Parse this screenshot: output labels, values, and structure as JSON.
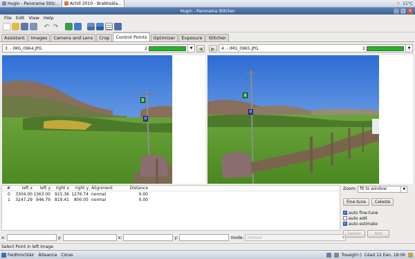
{
  "topbar": {
    "tabs": [
      {
        "label": "Hugin - Panorama Stitc...",
        "active": false
      },
      {
        "label": "Achill 2010 - Brabhsála...",
        "active": true
      }
    ],
    "weather": "11°C"
  },
  "window": {
    "title": "Hugin - Panorama Stitcher"
  },
  "menu": {
    "file": "File",
    "edit": "Edit",
    "view": "View",
    "help": "Help"
  },
  "toolbar": {
    "icons": [
      "new-icon",
      "open-icon",
      "save-icon",
      "save-as-icon",
      "undo-icon",
      "redo-icon",
      "preview-icon",
      "fast-preview-icon",
      "images-icon",
      "align-icon",
      "optimize-icon",
      "stitch-icon"
    ]
  },
  "tabs": [
    {
      "label": "Assistant",
      "active": false
    },
    {
      "label": "Images",
      "active": false
    },
    {
      "label": "Camera and Lens",
      "active": false
    },
    {
      "label": "Crop",
      "active": false
    },
    {
      "label": "Control Points",
      "active": true
    },
    {
      "label": "Optimizer",
      "active": false
    },
    {
      "label": "Exposure",
      "active": false
    },
    {
      "label": "Stitcher",
      "active": false
    }
  ],
  "left_image": {
    "selected": "3. - IMG_0964.JPG",
    "count": "2",
    "quality": 1.0
  },
  "right_image": {
    "selected": "4. - IMG_0965.JPG",
    "count": "2",
    "quality": 1.0
  },
  "nav": {
    "left_arrow": "◀",
    "right_arrow": "▶"
  },
  "control_points": {
    "headers": [
      "#",
      "left x",
      "left y",
      "right x",
      "right y",
      "Alignment",
      "Distance"
    ],
    "rows": [
      [
        "0",
        "3304.00",
        "1363.00",
        "915.36",
        "1276.74",
        "normal",
        "0.00"
      ],
      [
        "1",
        "3247.29",
        "946.79",
        "819.41",
        "800.05",
        "normal",
        "0.00"
      ]
    ],
    "markers": [
      "0",
      "1"
    ]
  },
  "zoom": {
    "label": "Zoom:",
    "value": "fit to window"
  },
  "buttons": {
    "fine_tune": "Fine-tune",
    "celeste": "Celeste",
    "delete": "Delete",
    "add": "Add"
  },
  "options": {
    "auto_fine_tune": {
      "label": "auto fine-tune",
      "checked": true
    },
    "auto_add": {
      "label": "auto add",
      "checked": false
    },
    "auto_estimate": {
      "label": "auto estimate",
      "checked": true
    }
  },
  "coords": {
    "x1_label": "x:",
    "y1_label": "y:",
    "x2_label": "x:",
    "y2_label": "y:",
    "mode_label": "mode:",
    "mode_value": "normal"
  },
  "status": {
    "text": "Select Point in left image"
  },
  "taskbar": {
    "apps": "Feidhmchláir",
    "places": "Áiteanna",
    "system": "Córas",
    "user": "Tosaigh!:)",
    "clock": "Céad 12 Ean, 18:06"
  },
  "colors": {
    "accent": "#3d6298",
    "cp_green": "#2ecb2e",
    "cp_blue": "#2940c8",
    "quality_bar": "#16c016"
  }
}
